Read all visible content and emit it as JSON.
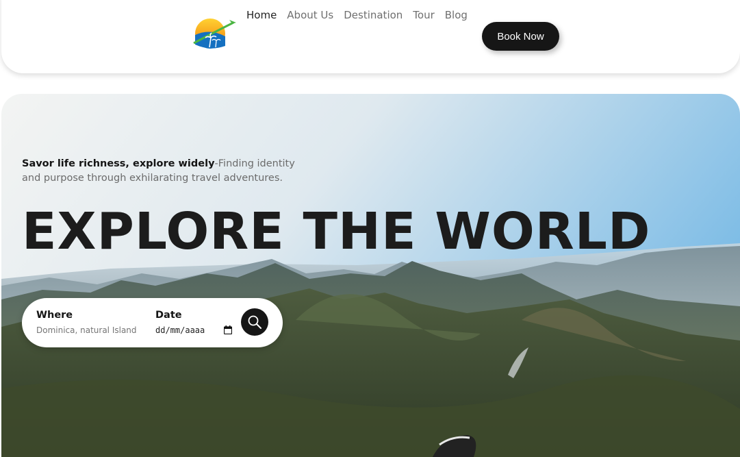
{
  "header": {
    "logo_alt": "travel logo",
    "nav": [
      {
        "label": "Home",
        "active": true
      },
      {
        "label": "About Us",
        "active": false
      },
      {
        "label": "Destination",
        "active": false
      },
      {
        "label": "Tour",
        "active": false
      },
      {
        "label": "Blog",
        "active": false
      }
    ],
    "book_label": "Book Now"
  },
  "hero": {
    "tagline_bold": "Savor life richness, explore widely",
    "tagline_rest": "-Finding identity and purpose through exhilarating travel adventures.",
    "title": "EXPLORE THE WORLD"
  },
  "search": {
    "where_label": "Where",
    "where_placeholder": "Dominica, natural Island",
    "date_label": "Date",
    "date_placeholder": "dd/mm/aaaa",
    "date_icon": "calendar-icon",
    "button_icon": "search-icon"
  },
  "colors": {
    "dark": "#161616",
    "nav_inactive": "#6f6f6f",
    "sky": "#8fc3e8"
  }
}
